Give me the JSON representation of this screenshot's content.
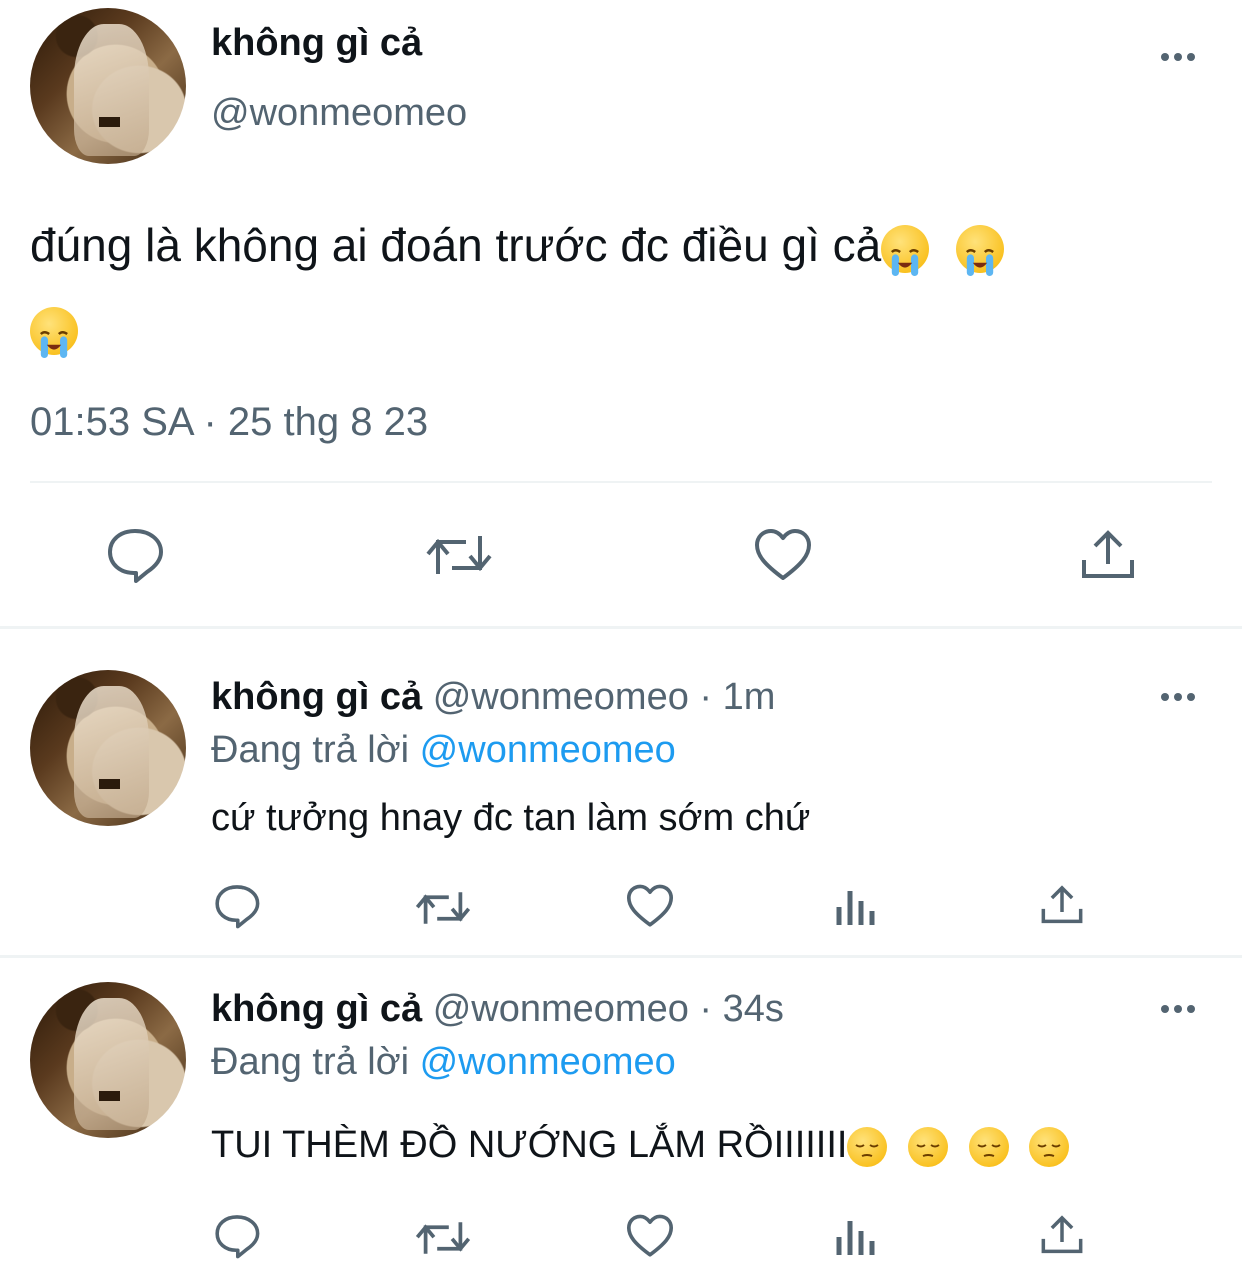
{
  "main_tweet": {
    "display_name": "không gì cả",
    "handle": "@wonmeomeo",
    "text": "đúng là không ai đoán trước đc điều gì cả",
    "emoji": [
      "loudly-crying-face",
      "loudly-crying-face",
      "loudly-crying-face"
    ],
    "timestamp": "01:53 SA · 25 thg 8 23"
  },
  "replies": [
    {
      "display_name": "không gì cả",
      "handle": "@wonmeomeo",
      "time": "· 1m",
      "replying_prefix": "Đang trả lời",
      "replying_to": "@wonmeomeo",
      "text": "cứ tưởng hnay đc tan làm sớm chứ"
    },
    {
      "display_name": "không gì cả",
      "handle": "@wonmeomeo",
      "time": "· 34s",
      "replying_prefix": "Đang trả lời",
      "replying_to": "@wonmeomeo",
      "text": "TUI THÈM ĐỒ NƯỚNG LẮM RỒIIIIIII",
      "emoji": [
        "pensive-face",
        "pensive-face",
        "pensive-face",
        "pensive-face"
      ]
    }
  ],
  "colors": {
    "text": "#0f1419",
    "muted": "#536471",
    "link": "#1d9bf0",
    "divider": "#eff3f4"
  }
}
